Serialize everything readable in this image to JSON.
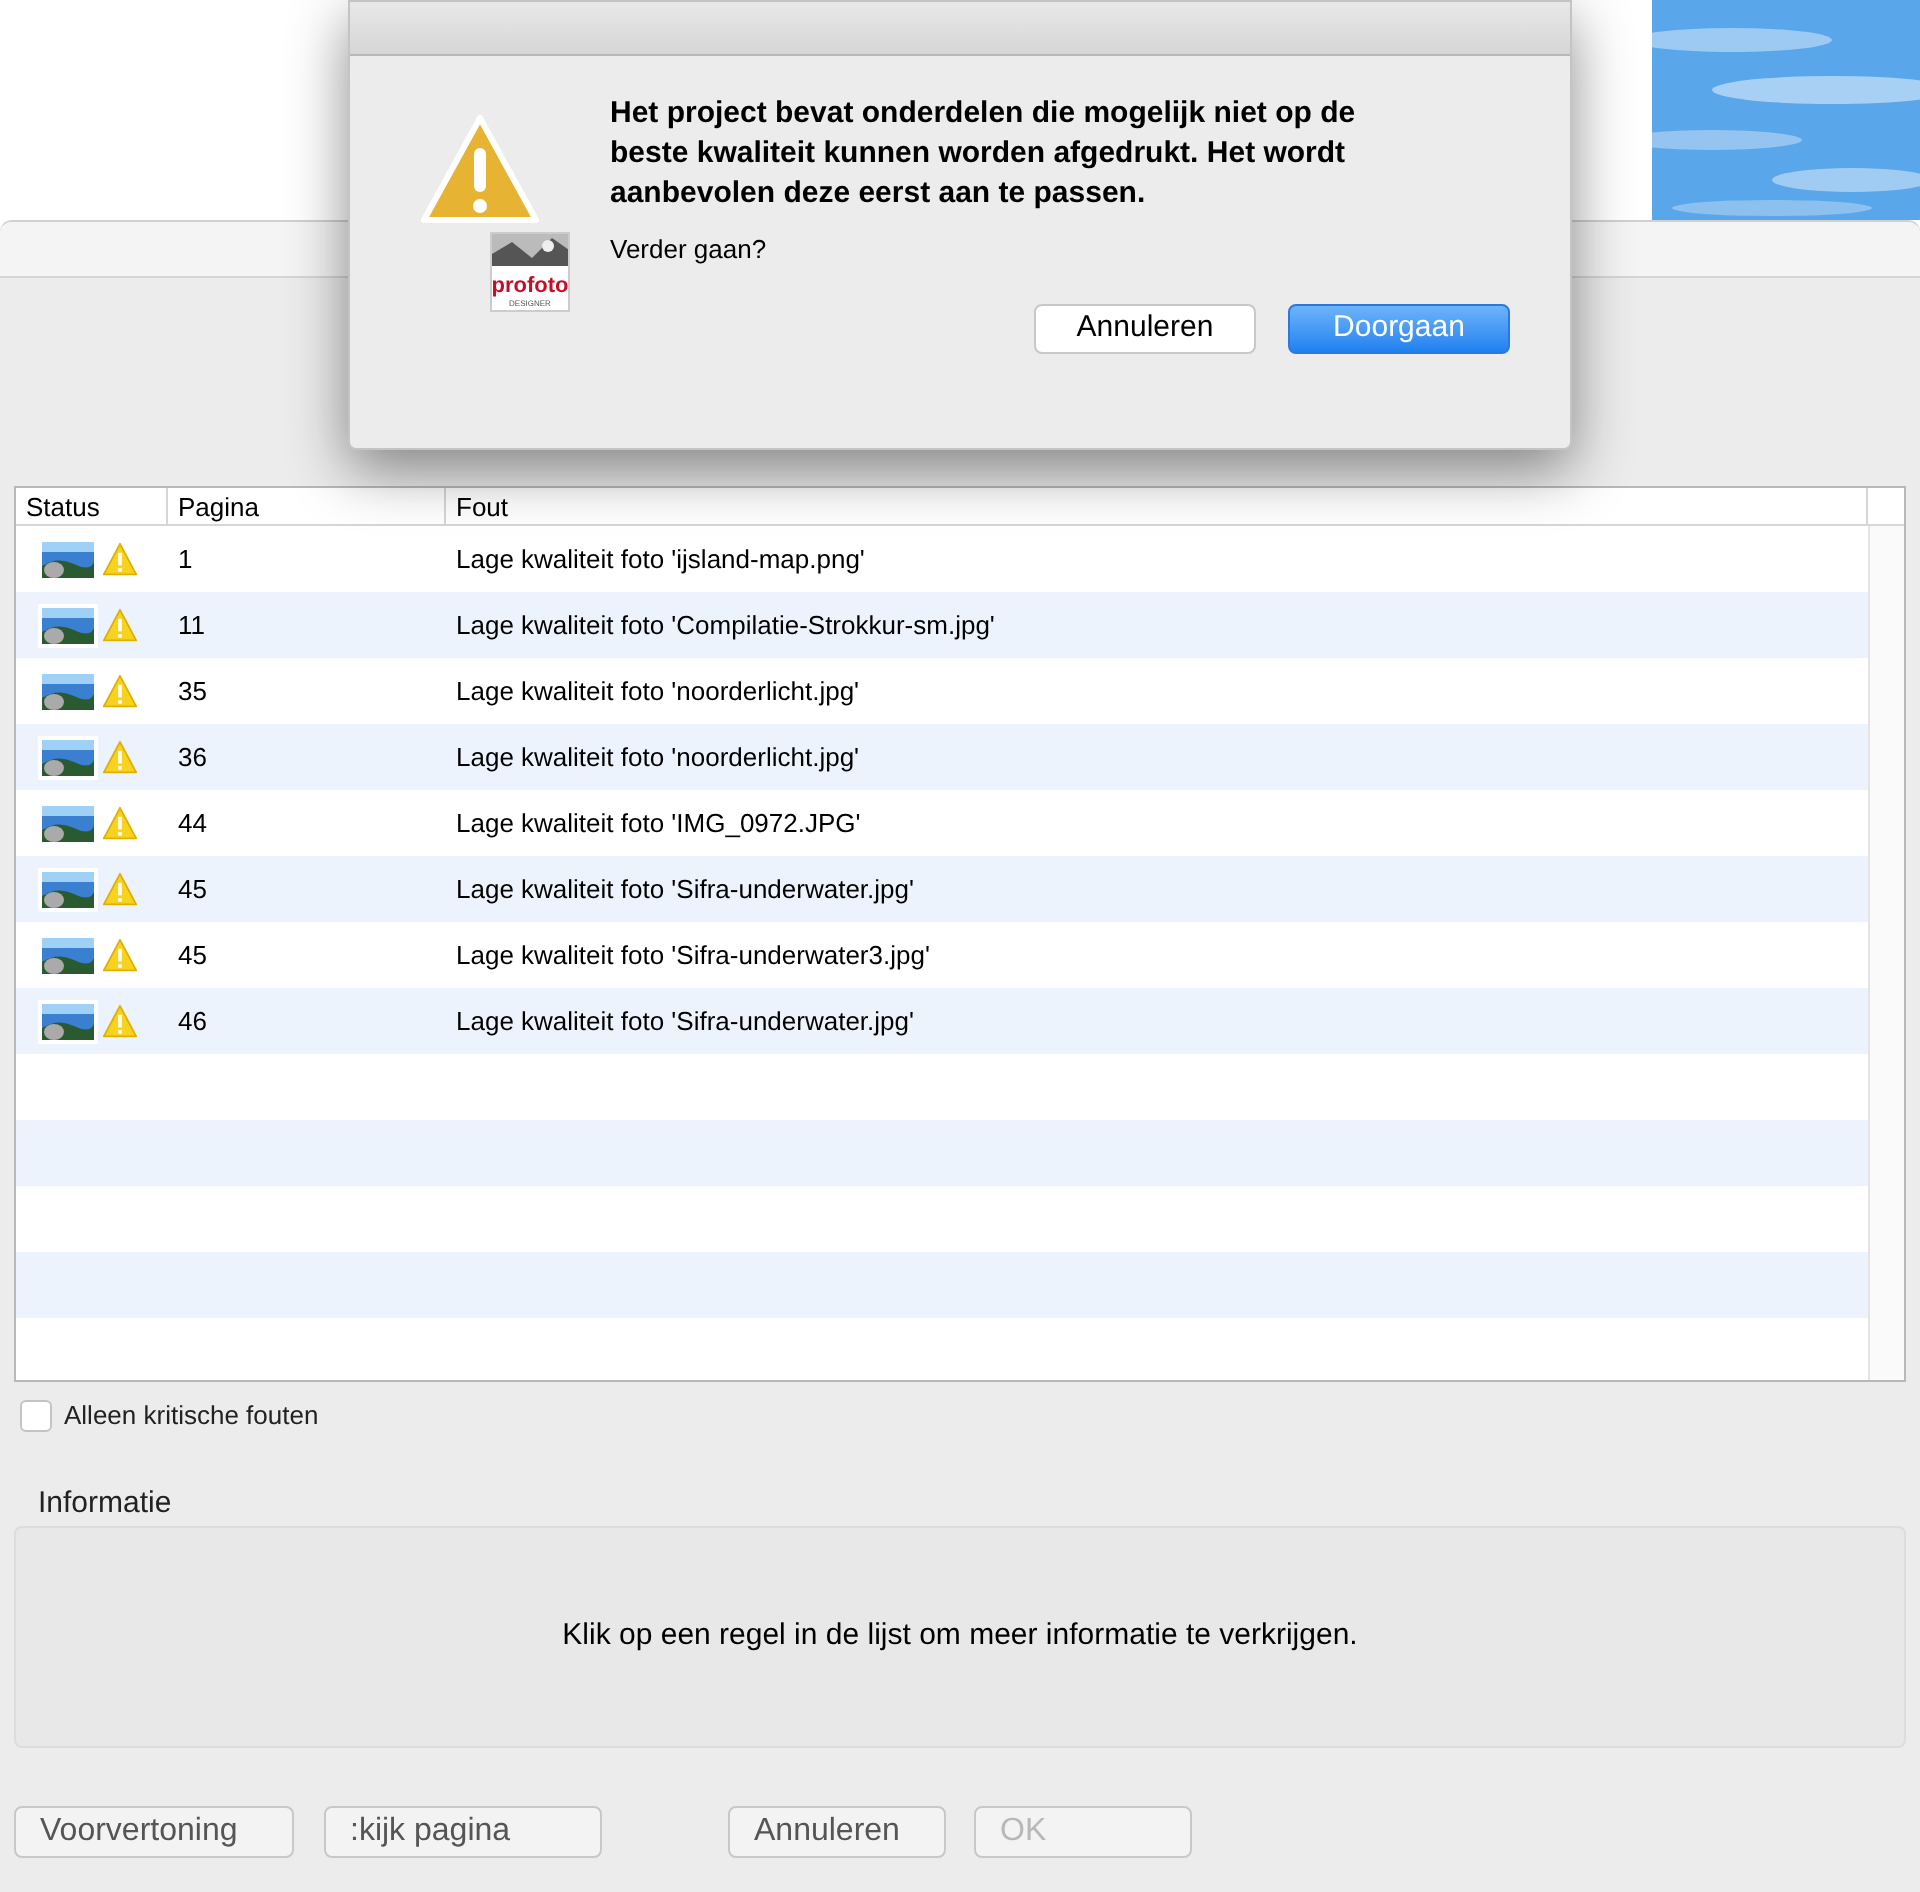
{
  "table": {
    "columns": [
      "Status",
      "Pagina",
      "Fout"
    ],
    "rows": [
      {
        "pagina": "1",
        "fout": "Lage kwaliteit foto 'ijsland-map.png'"
      },
      {
        "pagina": "11",
        "fout": "Lage kwaliteit foto 'Compilatie-Strokkur-sm.jpg'"
      },
      {
        "pagina": "35",
        "fout": "Lage kwaliteit foto 'noorderlicht.jpg'"
      },
      {
        "pagina": "36",
        "fout": "Lage kwaliteit foto 'noorderlicht.jpg'"
      },
      {
        "pagina": "44",
        "fout": "Lage kwaliteit foto 'IMG_0972.JPG'"
      },
      {
        "pagina": "45",
        "fout": "Lage kwaliteit foto 'Sifra-underwater.jpg'"
      },
      {
        "pagina": "45",
        "fout": "Lage kwaliteit foto 'Sifra-underwater3.jpg'"
      },
      {
        "pagina": "46",
        "fout": "Lage kwaliteit foto 'Sifra-underwater.jpg'"
      }
    ]
  },
  "filter": {
    "label": "Alleen kritische fouten",
    "checked": false
  },
  "info": {
    "title": "Informatie",
    "text": "Klik op een regel in de lijst om meer informatie te verkrijgen."
  },
  "buttons": [
    {
      "label": "Voorvertoning",
      "disabled": false
    },
    {
      "label": ":kijk pagina",
      "disabled": false
    },
    {
      "label": "Annuleren",
      "disabled": false
    },
    {
      "label": "OK",
      "disabled": true
    }
  ],
  "alert": {
    "message": "Het project bevat onderdelen die mogelijk niet op de beste kwaliteit kunnen worden afgedrukt. Het wordt aanbevolen deze eerst aan te passen.",
    "question": "Verder gaan?",
    "logo_text": "profoto",
    "logo_sub": "DESIGNER",
    "buttons": [
      {
        "label": "Annuleren",
        "default": false
      },
      {
        "label": "Doorgaan",
        "default": true
      }
    ]
  }
}
